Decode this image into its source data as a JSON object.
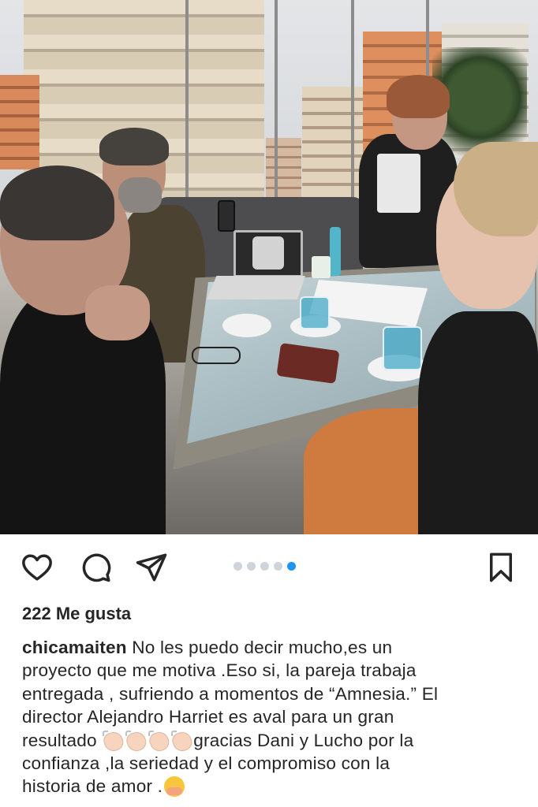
{
  "post": {
    "photo_description": "",
    "carousel": {
      "count": 5,
      "active_index": 4
    }
  },
  "actions": {
    "like_icon": "heart-icon",
    "comment_icon": "comment-icon",
    "share_icon": "send-icon",
    "save_icon": "bookmark-icon"
  },
  "likes": {
    "text": "222 Me gusta"
  },
  "caption": {
    "username": "chicamaiten",
    "line1": " No les puedo decir mucho,es un",
    "line2": "proyecto que me motiva .Eso si, la pareja trabaja",
    "line3": "entregada , sufriendo a momentos de “Amnesia.” El",
    "line4": "director Alejandro Harriet es aval para  un gran",
    "line5a": "resultado ",
    "line5b": "gracias Dani y Lucho por la",
    "line6": "confianza ,la seriedad  y el compromiso  con la",
    "line7": "historia  de amor ."
  },
  "colors": {
    "text": "#262626",
    "carousel_active": "#1f95ee",
    "carousel_inactive": "#cfd4da"
  }
}
